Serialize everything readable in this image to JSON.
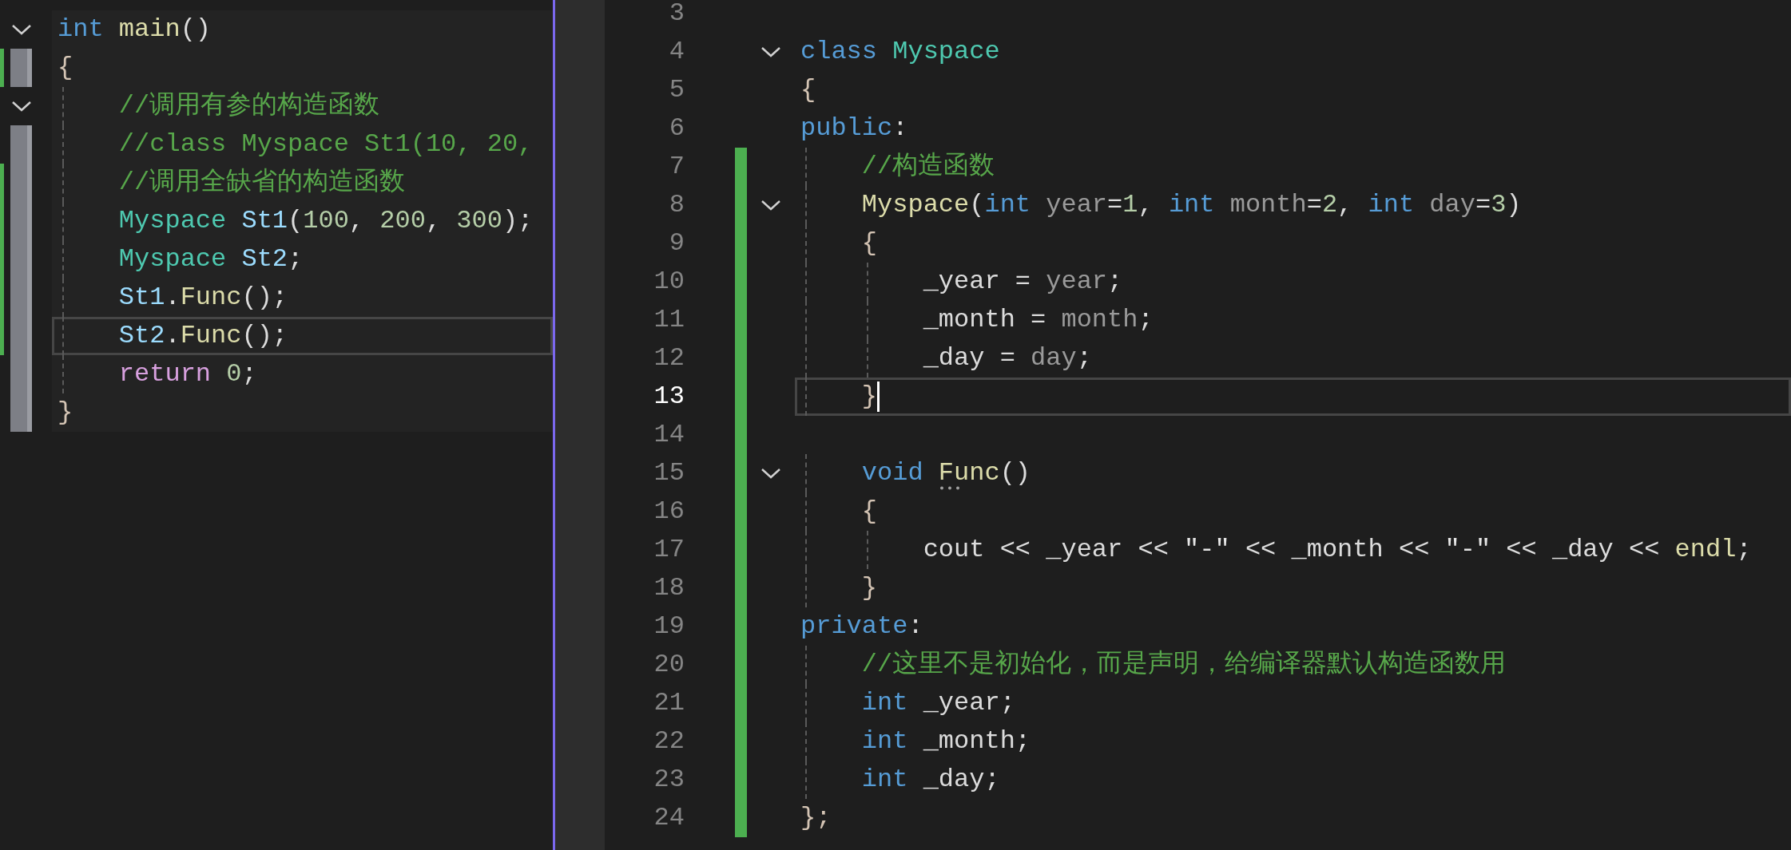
{
  "left_pane": {
    "lines": [
      {
        "tokens": [
          {
            "text": "int ",
            "kind": "keyword"
          },
          {
            "text": "main",
            "kind": "function"
          },
          {
            "text": "()",
            "kind": "plain"
          }
        ],
        "foldable": true,
        "modified": false,
        "marked": false,
        "current": false
      },
      {
        "tokens": [
          {
            "text": "{",
            "kind": "brace"
          }
        ],
        "foldable": false,
        "modified": true,
        "marked": true,
        "current": false
      },
      {
        "tokens": [
          {
            "text": "    //调用有参的构造函数",
            "kind": "comment"
          }
        ],
        "foldable": true,
        "modified": false,
        "marked": false,
        "current": false
      },
      {
        "tokens": [
          {
            "text": "    //class Myspace St1(10, 20,",
            "kind": "comment"
          }
        ],
        "foldable": false,
        "modified": false,
        "marked": true,
        "current": false
      },
      {
        "tokens": [
          {
            "text": "    //调用全缺省的构造函数",
            "kind": "comment"
          }
        ],
        "foldable": false,
        "modified": true,
        "marked": true,
        "current": false
      },
      {
        "tokens": [
          {
            "text": "    Myspace ",
            "kind": "type"
          },
          {
            "text": "St1",
            "kind": "variable"
          },
          {
            "text": "(",
            "kind": "plain"
          },
          {
            "text": "100",
            "kind": "number"
          },
          {
            "text": ", ",
            "kind": "plain"
          },
          {
            "text": "200",
            "kind": "number"
          },
          {
            "text": ", ",
            "kind": "plain"
          },
          {
            "text": "300",
            "kind": "number"
          },
          {
            "text": ");",
            "kind": "plain"
          }
        ],
        "foldable": false,
        "modified": true,
        "marked": true,
        "current": false
      },
      {
        "tokens": [
          {
            "text": "    Myspace ",
            "kind": "type"
          },
          {
            "text": "St2",
            "kind": "variable"
          },
          {
            "text": ";",
            "kind": "plain"
          }
        ],
        "foldable": false,
        "modified": true,
        "marked": true,
        "current": false
      },
      {
        "tokens": [
          {
            "text": "    St1",
            "kind": "variable"
          },
          {
            "text": ".",
            "kind": "plain"
          },
          {
            "text": "Func",
            "kind": "function"
          },
          {
            "text": "();",
            "kind": "plain"
          }
        ],
        "foldable": false,
        "modified": true,
        "marked": true,
        "current": false
      },
      {
        "tokens": [
          {
            "text": "    St2",
            "kind": "variable"
          },
          {
            "text": ".",
            "kind": "plain"
          },
          {
            "text": "Func",
            "kind": "function"
          },
          {
            "text": "();",
            "kind": "plain"
          }
        ],
        "foldable": false,
        "modified": true,
        "marked": true,
        "current": true
      },
      {
        "tokens": [
          {
            "text": "    return ",
            "kind": "control"
          },
          {
            "text": "0",
            "kind": "number"
          },
          {
            "text": ";",
            "kind": "plain"
          }
        ],
        "foldable": false,
        "modified": false,
        "marked": true,
        "current": false
      },
      {
        "tokens": [
          {
            "text": "}",
            "kind": "brace"
          }
        ],
        "foldable": false,
        "modified": false,
        "marked": true,
        "current": false
      }
    ]
  },
  "right_pane": {
    "lines": [
      {
        "number": "3",
        "foldable": false,
        "modified": false,
        "current": false,
        "cursor": false
      },
      {
        "number": "4",
        "tokens": [
          {
            "text": "class ",
            "kind": "keyword"
          },
          {
            "text": "Myspace",
            "kind": "type"
          }
        ],
        "foldable": true,
        "modified": false,
        "current": false,
        "cursor": false
      },
      {
        "number": "5",
        "tokens": [
          {
            "text": "{",
            "kind": "brace"
          }
        ],
        "foldable": false,
        "modified": false,
        "current": false,
        "cursor": false
      },
      {
        "number": "6",
        "tokens": [
          {
            "text": "public",
            "kind": "keyword"
          },
          {
            "text": ":",
            "kind": "plain"
          }
        ],
        "foldable": false,
        "modified": false,
        "current": false,
        "cursor": false
      },
      {
        "number": "7",
        "tokens": [
          {
            "text": "    //构造函数",
            "kind": "comment"
          }
        ],
        "foldable": false,
        "modified": true,
        "current": false,
        "cursor": false
      },
      {
        "number": "8",
        "tokens": [
          {
            "text": "    Myspace",
            "kind": "function"
          },
          {
            "text": "(",
            "kind": "plain"
          },
          {
            "text": "int ",
            "kind": "keyword"
          },
          {
            "text": "year",
            "kind": "param"
          },
          {
            "text": "=",
            "kind": "plain"
          },
          {
            "text": "1",
            "kind": "number"
          },
          {
            "text": ", ",
            "kind": "plain"
          },
          {
            "text": "int ",
            "kind": "keyword"
          },
          {
            "text": "month",
            "kind": "param"
          },
          {
            "text": "=",
            "kind": "plain"
          },
          {
            "text": "2",
            "kind": "number"
          },
          {
            "text": ", ",
            "kind": "plain"
          },
          {
            "text": "int ",
            "kind": "keyword"
          },
          {
            "text": "day",
            "kind": "param"
          },
          {
            "text": "=",
            "kind": "plain"
          },
          {
            "text": "3",
            "kind": "number"
          },
          {
            "text": ")",
            "kind": "plain"
          }
        ],
        "foldable": true,
        "modified": true,
        "current": false,
        "cursor": false
      },
      {
        "number": "9",
        "tokens": [
          {
            "text": "    {",
            "kind": "brace"
          }
        ],
        "foldable": false,
        "modified": true,
        "current": false,
        "cursor": false
      },
      {
        "number": "10",
        "tokens": [
          {
            "text": "        _year = ",
            "kind": "plain"
          },
          {
            "text": "year",
            "kind": "param"
          },
          {
            "text": ";",
            "kind": "plain"
          }
        ],
        "foldable": false,
        "modified": true,
        "current": false,
        "cursor": false
      },
      {
        "number": "11",
        "tokens": [
          {
            "text": "        _month = ",
            "kind": "plain"
          },
          {
            "text": "month",
            "kind": "param"
          },
          {
            "text": ";",
            "kind": "plain"
          }
        ],
        "foldable": false,
        "modified": true,
        "current": false,
        "cursor": false
      },
      {
        "number": "12",
        "tokens": [
          {
            "text": "        _day = ",
            "kind": "plain"
          },
          {
            "text": "day",
            "kind": "param"
          },
          {
            "text": ";",
            "kind": "plain"
          }
        ],
        "foldable": false,
        "modified": true,
        "current": false,
        "cursor": false
      },
      {
        "number": "13",
        "tokens": [
          {
            "text": "    }",
            "kind": "brace"
          }
        ],
        "foldable": false,
        "modified": true,
        "current": true,
        "cursor": true
      },
      {
        "number": "14",
        "foldable": false,
        "modified": true,
        "current": false,
        "cursor": false
      },
      {
        "number": "15",
        "tokens": [
          {
            "text": "    void ",
            "kind": "keyword"
          },
          {
            "text": "Func",
            "kind": "function",
            "hint": true
          },
          {
            "text": "()",
            "kind": "plain"
          }
        ],
        "foldable": true,
        "modified": true,
        "current": false,
        "cursor": false
      },
      {
        "number": "16",
        "tokens": [
          {
            "text": "    {",
            "kind": "brace"
          }
        ],
        "foldable": false,
        "modified": true,
        "current": false,
        "cursor": false
      },
      {
        "number": "17",
        "tokens": [
          {
            "text": "        cout << _year << ",
            "kind": "plain"
          },
          {
            "text": "\"-\"",
            "kind": "string"
          },
          {
            "text": " << _month << ",
            "kind": "plain"
          },
          {
            "text": "\"-\"",
            "kind": "string"
          },
          {
            "text": " << _day << ",
            "kind": "plain"
          },
          {
            "text": "endl",
            "kind": "function"
          },
          {
            "text": ";",
            "kind": "plain"
          }
        ],
        "foldable": false,
        "modified": true,
        "current": false,
        "cursor": false
      },
      {
        "number": "18",
        "tokens": [
          {
            "text": "    }",
            "kind": "brace"
          }
        ],
        "foldable": false,
        "modified": true,
        "current": false,
        "cursor": false
      },
      {
        "number": "19",
        "tokens": [
          {
            "text": "private",
            "kind": "keyword"
          },
          {
            "text": ":",
            "kind": "plain"
          }
        ],
        "foldable": false,
        "modified": true,
        "current": false,
        "cursor": false
      },
      {
        "number": "20",
        "tokens": [
          {
            "text": "    //这里不是初始化，而是声明，给编译器默认构造函数用",
            "kind": "comment"
          }
        ],
        "foldable": false,
        "modified": true,
        "current": false,
        "cursor": false
      },
      {
        "number": "21",
        "tokens": [
          {
            "text": "    int",
            "kind": "keyword"
          },
          {
            "text": " _year;",
            "kind": "plain"
          }
        ],
        "foldable": false,
        "modified": true,
        "current": false,
        "cursor": false
      },
      {
        "number": "22",
        "tokens": [
          {
            "text": "    int",
            "kind": "keyword"
          },
          {
            "text": " _month;",
            "kind": "plain"
          }
        ],
        "foldable": false,
        "modified": true,
        "current": false,
        "cursor": false
      },
      {
        "number": "23",
        "tokens": [
          {
            "text": "    int",
            "kind": "keyword"
          },
          {
            "text": " _day;",
            "kind": "plain"
          }
        ],
        "foldable": false,
        "modified": true,
        "current": false,
        "cursor": false
      },
      {
        "number": "24",
        "tokens": [
          {
            "text": "};",
            "kind": "brace"
          }
        ],
        "foldable": false,
        "modified": true,
        "current": false,
        "cursor": false
      }
    ]
  }
}
